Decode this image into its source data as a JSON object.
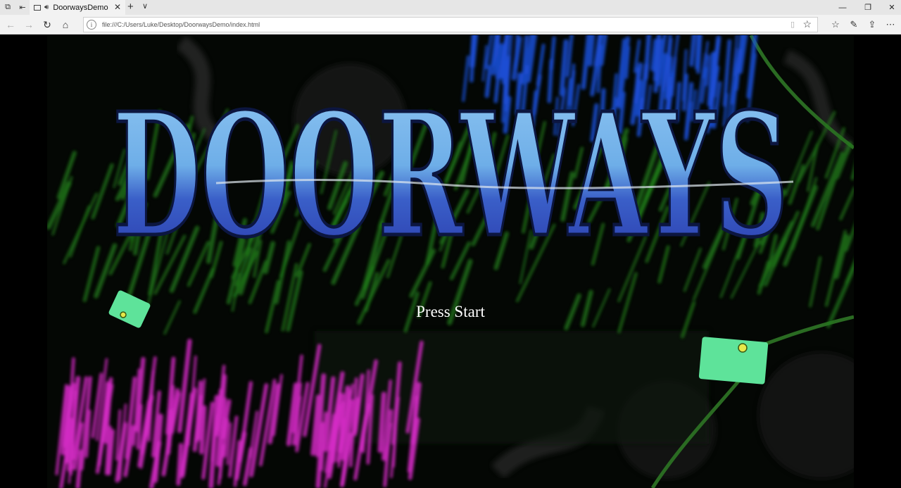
{
  "browser": {
    "tab": {
      "title": "DoorwaysDemo"
    },
    "address": {
      "url": "file:///C:/Users/Luke/Desktop/DoorwaysDemo/index.html"
    },
    "icons": {
      "tab_preview": "tab-preview-icon",
      "set_aside": "set-aside-tabs-icon",
      "audio": "speaker-icon",
      "new_tab": "plus-icon",
      "tab_list": "chevron-down-icon",
      "back": "arrow-left-icon",
      "forward": "arrow-right-icon",
      "refresh": "refresh-icon",
      "home": "home-icon",
      "favorites": "star-icon",
      "favorites_hub": "favorites-list-icon",
      "web_note": "pen-icon",
      "share": "share-icon",
      "more": "ellipsis-icon"
    }
  },
  "game": {
    "logo": "DOORWAYS",
    "prompt": "Press Start",
    "colors": {
      "logo_top": "#8fc6f2",
      "logo_bottom": "#2836a8",
      "grass_green": "#1f7a1a",
      "grass_blue": "#1b4fd6",
      "grass_magenta": "#d42bc4",
      "door_green": "#5ee39a"
    }
  }
}
